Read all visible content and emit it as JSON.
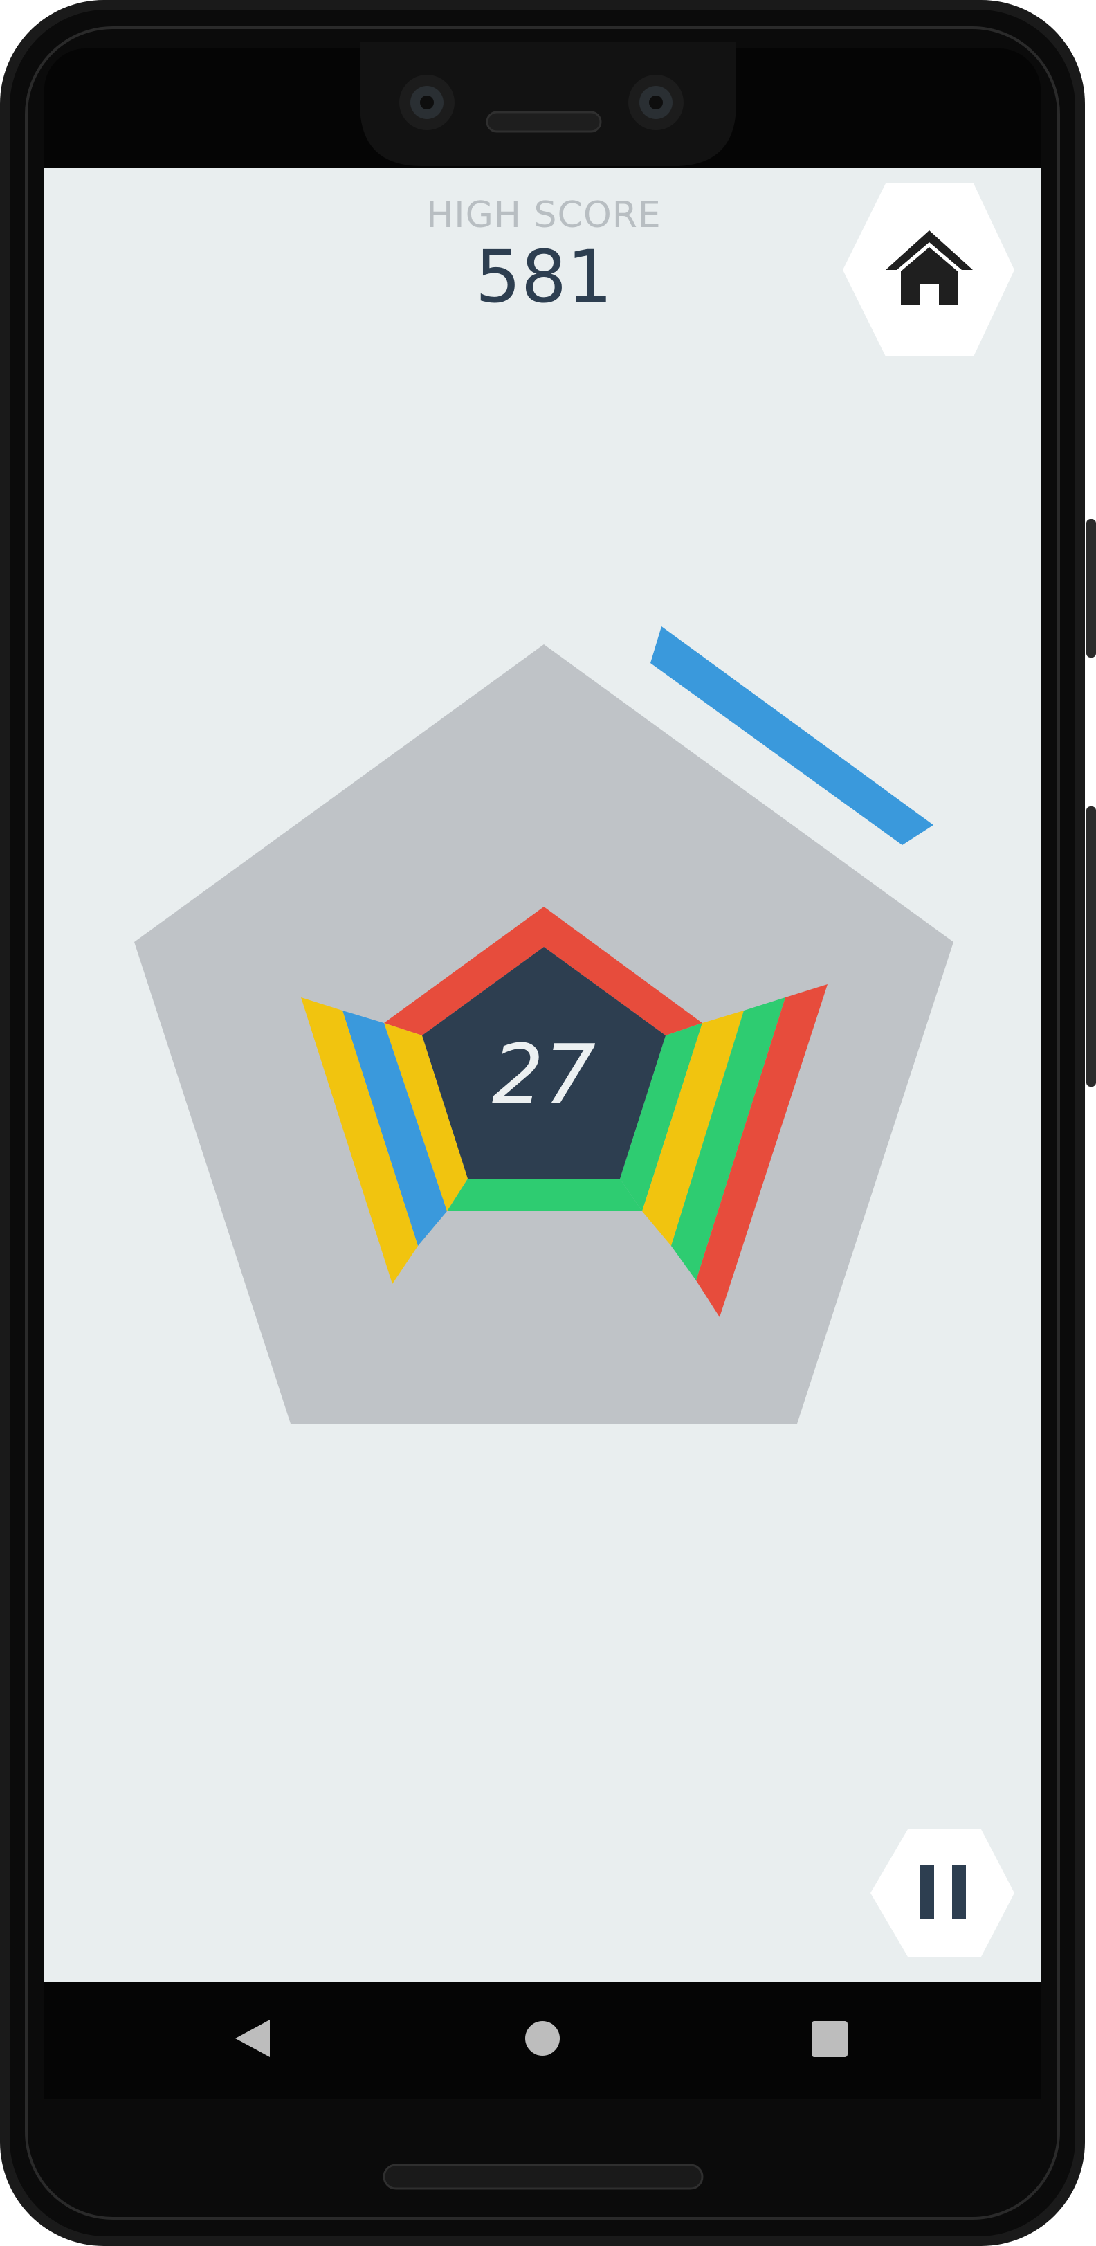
{
  "game": {
    "high_score_label": "HIGH SCORE",
    "high_score_value": "581",
    "current_score": "27"
  },
  "buttons": {
    "home_icon": "home-icon",
    "pause_icon": "pause-icon"
  },
  "nav_bar": {
    "back_icon": "back-triangle-icon",
    "home_icon": "home-circle-icon",
    "recents_icon": "recents-square-icon"
  },
  "colors": {
    "screen_background": "#e9eeef",
    "playfield": "#bfc3c7",
    "core": "#2d3e50",
    "red": "#e74c3c",
    "blue": "#3a99dc",
    "yellow": "#f1c40f",
    "green": "#2ecc71",
    "text_dark": "#2d3e50",
    "text_muted": "#b8bec2",
    "device_frame": "#0b0b0b"
  }
}
